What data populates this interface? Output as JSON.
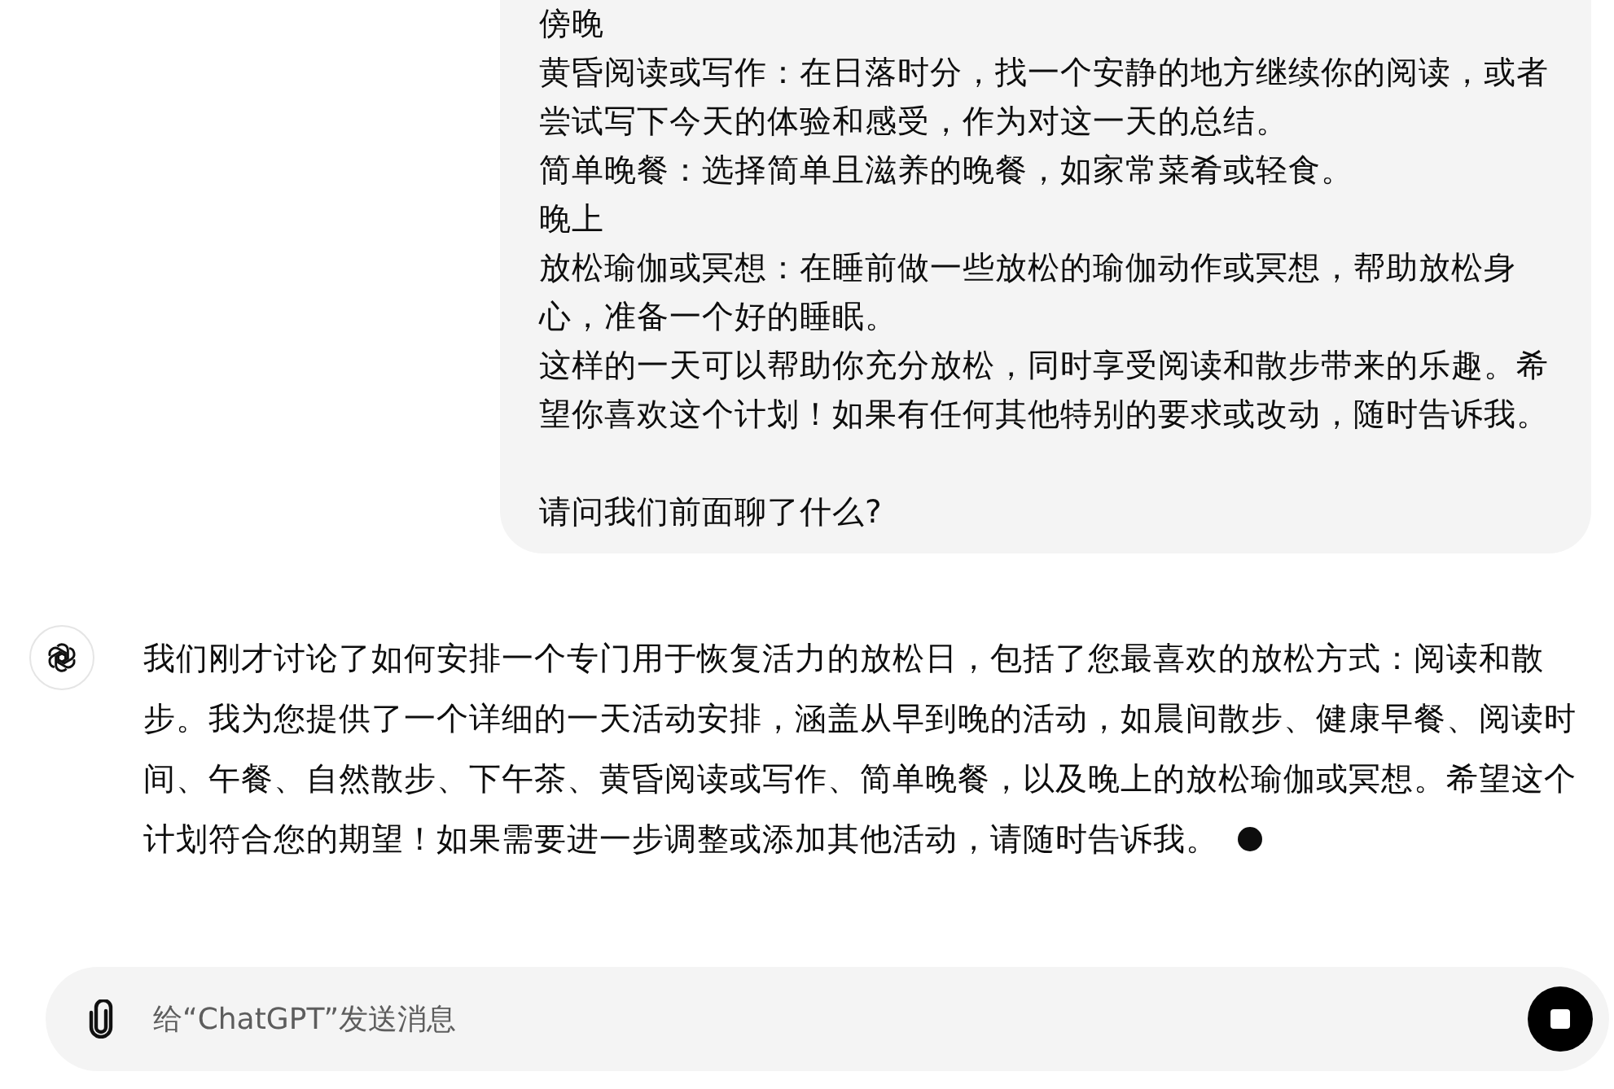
{
  "user_message": {
    "paragraphs": [
      "傍晚",
      "黄昏阅读或写作：在日落时分，找一个安静的地方继续你的阅读，或者尝试写下今天的体验和感受，作为对这一天的总结。",
      "简单晚餐：选择简单且滋养的晚餐，如家常菜肴或轻食。",
      "晚上",
      "放松瑜伽或冥想：在睡前做一些放松的瑜伽动作或冥想，帮助放松身心，准备一个好的睡眠。",
      "这样的一天可以帮助你充分放松，同时享受阅读和散步带来的乐趣。希望你喜欢这个计划！如果有任何其他特别的要求或改动，随时告诉我。"
    ],
    "question": "请问我们前面聊了什么?"
  },
  "assistant_message": {
    "text": "我们刚才讨论了如何安排一个专门用于恢复活力的放松日，包括了您最喜欢的放松方式：阅读和散步。我为您提供了一个详细的一天活动安排，涵盖从早到晚的活动，如晨间散步、健康早餐、阅读时间、午餐、自然散步、下午茶、黄昏阅读或写作、简单晚餐，以及晚上的放松瑜伽或冥想。希望这个计划符合您的期望！如果需要进一步调整或添加其他活动，请随时告诉我。",
    "streaming": true
  },
  "composer": {
    "placeholder": "给“ChatGPT”发送消息",
    "generating": true
  }
}
